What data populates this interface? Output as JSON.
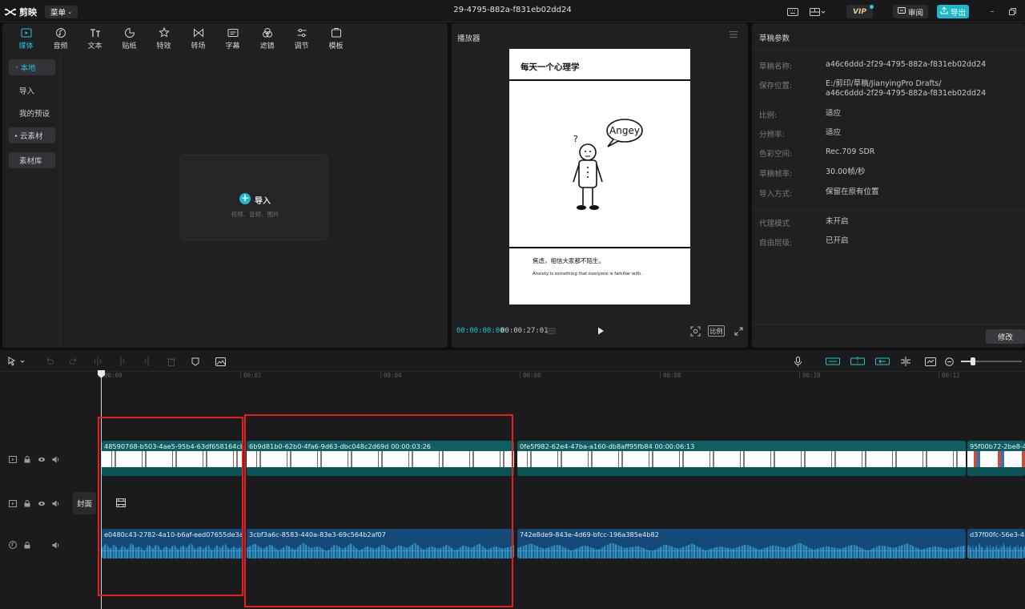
{
  "titlebar": {
    "app_name": "剪映",
    "menu_label": "菜单",
    "project_title": "29-4795-882a-f831eb02dd24",
    "vip_label": "VIP",
    "review_label": "审阅",
    "export_label": "导出"
  },
  "media_toolbar": {
    "tools": [
      {
        "label": "媒体",
        "icon": "media-icon",
        "active": true
      },
      {
        "label": "音频",
        "icon": "audio-icon"
      },
      {
        "label": "文本",
        "icon": "text-icon"
      },
      {
        "label": "贴纸",
        "icon": "sticker-icon"
      },
      {
        "label": "特效",
        "icon": "effects-icon"
      },
      {
        "label": "转场",
        "icon": "transition-icon"
      },
      {
        "label": "字幕",
        "icon": "caption-icon"
      },
      {
        "label": "滤镜",
        "icon": "filter-icon"
      },
      {
        "label": "调节",
        "icon": "adjust-icon"
      },
      {
        "label": "模板",
        "icon": "template-icon"
      }
    ]
  },
  "media_sidebar": {
    "local": "本地",
    "import": "导入",
    "my_presets": "我的预设",
    "cloud": "云素材",
    "library": "素材库"
  },
  "import_card": {
    "label": "导入",
    "sub": "视频、音频、图片"
  },
  "player": {
    "title": "播放器",
    "preview": {
      "title": "每天一个心理学",
      "bubble": "Angey",
      "caption_cn": "焦虑，相信大家都不陌生。",
      "caption_en": "Anxiety is something that everyone is familiar with."
    },
    "time_current": "00:00:00:00",
    "time_total": "00:00:27:01",
    "ratio_label": "比例"
  },
  "draft": {
    "title": "草稿参数",
    "rows": [
      {
        "label": "草稿名称:",
        "value": "a46c6ddd-2f29-4795-882a-f831eb02dd24"
      },
      {
        "label": "保存位置:",
        "value": "E:/剪印/草稿/JianyingPro Drafts/",
        "value2": "a46c6ddd-2f29-4795-882a-f831eb02dd24"
      },
      {
        "label": "比例:",
        "value": "适应"
      },
      {
        "label": "分辨率:",
        "value": "适应"
      },
      {
        "label": "色彩空间:",
        "value": "Rec.709 SDR"
      },
      {
        "label": "草稿帧率:",
        "value": "30.00帧/秒"
      },
      {
        "label": "导入方式:",
        "value": "保留在原有位置"
      },
      {
        "label": "代理模式",
        "value": "未开启"
      },
      {
        "label": "自由层级:",
        "value": "已开启"
      }
    ],
    "modify_label": "修改"
  },
  "timeline": {
    "ticks": [
      "00:00",
      "00:02",
      "00:04",
      "00:06",
      "00:08",
      "00:10",
      "00:12"
    ],
    "cover_label": "封面",
    "video_clips": [
      {
        "label": "48590768-b503-4ae5-95b4-63df658164cb  00"
      },
      {
        "label": "6b9d81b0-62b0-4fa6-9d63-dbc048c2d69d  00:00:03:26"
      },
      {
        "label": "0fe5f982-62e4-47ba-a160-db8aff95fb84  00:00:06:13"
      },
      {
        "label": "95f00b72-2be8-40"
      }
    ],
    "audio_clips": [
      {
        "label": "e0480c43-2782-4a10-b6af-eed07655de3a"
      },
      {
        "label": "3cbf3a6c-8583-440a-83e3-69c564b2af07"
      },
      {
        "label": "742e8de9-843e-4d69-bfcc-196a385e4b82"
      },
      {
        "label": "d37f00fc-56e3-48b"
      }
    ]
  },
  "colors": {
    "accent": "#1fb8c9",
    "video_clip": "#0f5e62",
    "audio_clip": "#154a78",
    "highlight_box": "#e0221f"
  }
}
